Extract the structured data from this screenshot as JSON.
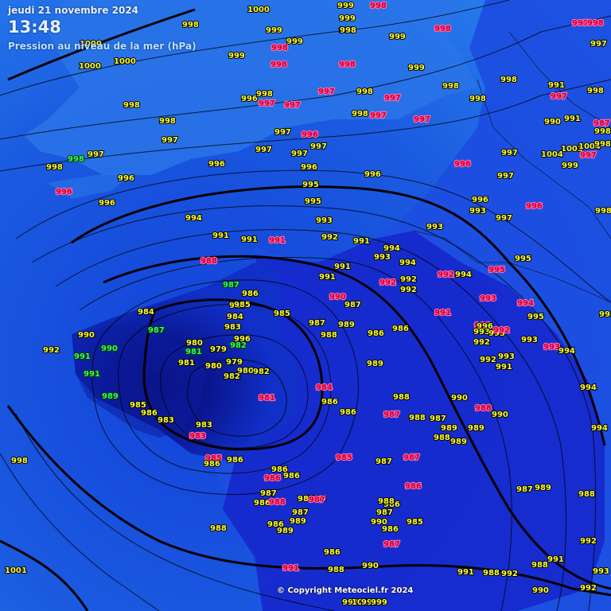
{
  "header": {
    "date": "jeudi 21 novembre 2024",
    "time": "13:48",
    "subtitle": "Pression au niveau de la mer (hPa)"
  },
  "copyright": "© Copyright Meteociel.fr 2024",
  "colors": {
    "normal_value": "#ffff33",
    "alert_value": "#cc0033",
    "alert_value_bg": "#ff66aa",
    "green_value": "#33ff66",
    "isobar": "#000000",
    "land_light": "#2070e0",
    "low_core": "#06169a"
  },
  "pressure_labels": [
    {
      "t": "1000",
      "c": "n"
    },
    {
      "t": "999",
      "c": "n"
    },
    {
      "t": "998",
      "c": "r"
    },
    {
      "t": "997",
      "c": "r"
    },
    {
      "t": "1000",
      "c": "n"
    },
    {
      "t": "998",
      "c": "n"
    },
    {
      "t": "999",
      "c": "n"
    },
    {
      "t": "998",
      "c": "r"
    },
    {
      "t": "1000",
      "c": "n"
    },
    {
      "t": "998",
      "c": "r"
    },
    {
      "t": "999",
      "c": "n"
    },
    {
      "t": "999",
      "c": "n"
    },
    {
      "t": "998",
      "c": "n"
    },
    {
      "t": "1000",
      "c": "n"
    },
    {
      "t": "999",
      "c": "n"
    },
    {
      "t": "998",
      "c": "r"
    },
    {
      "t": "998",
      "c": "r"
    },
    {
      "t": "998",
      "c": "n"
    },
    {
      "t": "999",
      "c": "n"
    },
    {
      "t": "998",
      "c": "r"
    },
    {
      "t": "999",
      "c": "n"
    },
    {
      "t": "998",
      "c": "n"
    },
    {
      "t": "998",
      "c": "n"
    },
    {
      "t": "998",
      "c": "n"
    },
    {
      "t": "996",
      "c": "n"
    },
    {
      "t": "998",
      "c": "n"
    },
    {
      "t": "997",
      "c": "r"
    },
    {
      "t": "997",
      "c": "r"
    },
    {
      "t": "997",
      "c": "r"
    },
    {
      "t": "998",
      "c": "n"
    },
    {
      "t": "997",
      "c": "r"
    },
    {
      "t": "997",
      "c": "r"
    },
    {
      "t": "998",
      "c": "n"
    },
    {
      "t": "997",
      "c": "r"
    },
    {
      "t": "997",
      "c": "n"
    },
    {
      "t": "998",
      "c": "n"
    },
    {
      "t": "997",
      "c": "n"
    },
    {
      "t": "996",
      "c": "r"
    },
    {
      "t": "997",
      "c": "n"
    },
    {
      "t": "997",
      "c": "r"
    },
    {
      "t": "998",
      "c": "n"
    },
    {
      "t": "998",
      "c": "n"
    },
    {
      "t": "997",
      "c": "n"
    },
    {
      "t": "997",
      "c": "n"
    },
    {
      "t": "997",
      "c": "n"
    },
    {
      "t": "996",
      "c": "n"
    },
    {
      "t": "996",
      "c": "n"
    },
    {
      "t": "996",
      "c": "r"
    },
    {
      "t": "996",
      "c": "n"
    },
    {
      "t": "997",
      "c": "n"
    },
    {
      "t": "996",
      "c": "n"
    },
    {
      "t": "998",
      "c": "g"
    },
    {
      "t": "998",
      "c": "n"
    },
    {
      "t": "997",
      "c": "n"
    },
    {
      "t": "996",
      "c": "r"
    },
    {
      "t": "996",
      "c": "n"
    },
    {
      "t": "995",
      "c": "n"
    },
    {
      "t": "995",
      "c": "n"
    },
    {
      "t": "994",
      "c": "n"
    },
    {
      "t": "993",
      "c": "n"
    },
    {
      "t": "993",
      "c": "n"
    },
    {
      "t": "996",
      "c": "n"
    },
    {
      "t": "997",
      "c": "n"
    },
    {
      "t": "997",
      "c": "n"
    },
    {
      "t": "998",
      "c": "n"
    },
    {
      "t": "996",
      "c": "r"
    },
    {
      "t": "991",
      "c": "n"
    },
    {
      "t": "991",
      "c": "n"
    },
    {
      "t": "991",
      "c": "r"
    },
    {
      "t": "992",
      "c": "n"
    },
    {
      "t": "991",
      "c": "n"
    },
    {
      "t": "994",
      "c": "n"
    },
    {
      "t": "993",
      "c": "n"
    },
    {
      "t": "988",
      "c": "r"
    },
    {
      "t": "991",
      "c": "n"
    },
    {
      "t": "993",
      "c": "n"
    },
    {
      "t": "991",
      "c": "n"
    },
    {
      "t": "992",
      "c": "r"
    },
    {
      "t": "994",
      "c": "n"
    },
    {
      "t": "992",
      "c": "n"
    },
    {
      "t": "992",
      "c": "n"
    },
    {
      "t": "995",
      "c": "n"
    },
    {
      "t": "992",
      "c": "r"
    },
    {
      "t": "994",
      "c": "n"
    },
    {
      "t": "995",
      "c": "r"
    },
    {
      "t": "987",
      "c": "g"
    },
    {
      "t": "986",
      "c": "n"
    },
    {
      "t": "990",
      "c": "r"
    },
    {
      "t": "987",
      "c": "n"
    },
    {
      "t": "991",
      "c": "r"
    },
    {
      "t": "993",
      "c": "r"
    },
    {
      "t": "994",
      "c": "r"
    },
    {
      "t": "984",
      "c": "n"
    },
    {
      "t": "985",
      "c": "n"
    },
    {
      "t": "984",
      "c": "n"
    },
    {
      "t": "985",
      "c": "n"
    },
    {
      "t": "985",
      "c": "n"
    },
    {
      "t": "987",
      "c": "n"
    },
    {
      "t": "989",
      "c": "n"
    },
    {
      "t": "986",
      "c": "n"
    },
    {
      "t": "991",
      "c": "r"
    },
    {
      "t": "996",
      "c": "n"
    },
    {
      "t": "995",
      "c": "n"
    },
    {
      "t": "993",
      "c": "n"
    },
    {
      "t": "998",
      "c": "n"
    },
    {
      "t": "987",
      "c": "g"
    },
    {
      "t": "983",
      "c": "n"
    },
    {
      "t": "988",
      "c": "n"
    },
    {
      "t": "986",
      "c": "n"
    },
    {
      "t": "993",
      "c": "n"
    },
    {
      "t": "992",
      "c": "r"
    },
    {
      "t": "993",
      "c": "n"
    },
    {
      "t": "993",
      "c": "r"
    },
    {
      "t": "994",
      "c": "n"
    },
    {
      "t": "990",
      "c": "n"
    },
    {
      "t": "990",
      "c": "g"
    },
    {
      "t": "980",
      "c": "n"
    },
    {
      "t": "979",
      "c": "n"
    },
    {
      "t": "982",
      "c": "g"
    },
    {
      "t": "996",
      "c": "n"
    },
    {
      "t": "992",
      "c": "n"
    },
    {
      "t": "991",
      "c": "g"
    },
    {
      "t": "981",
      "c": "g"
    },
    {
      "t": "992",
      "c": "n"
    },
    {
      "t": "992",
      "c": "n"
    },
    {
      "t": "993",
      "c": "n"
    },
    {
      "t": "991",
      "c": "n"
    },
    {
      "t": "991",
      "c": "g"
    },
    {
      "t": "981",
      "c": "n"
    },
    {
      "t": "980",
      "c": "n"
    },
    {
      "t": "979",
      "c": "n"
    },
    {
      "t": "980",
      "c": "n"
    },
    {
      "t": "982",
      "c": "n"
    },
    {
      "t": "989",
      "c": "n"
    },
    {
      "t": "982",
      "c": "n"
    },
    {
      "t": "984",
      "c": "r"
    },
    {
      "t": "994",
      "c": "n"
    },
    {
      "t": "989",
      "c": "g"
    },
    {
      "t": "981",
      "c": "r"
    },
    {
      "t": "988",
      "c": "n"
    },
    {
      "t": "990",
      "c": "n"
    },
    {
      "t": "985",
      "c": "n"
    },
    {
      "t": "986",
      "c": "n"
    },
    {
      "t": "986",
      "c": "n"
    },
    {
      "t": "988",
      "c": "r"
    },
    {
      "t": "990",
      "c": "n"
    },
    {
      "t": "986",
      "c": "n"
    },
    {
      "t": "983",
      "c": "n"
    },
    {
      "t": "987",
      "c": "r"
    },
    {
      "t": "988",
      "c": "n"
    },
    {
      "t": "987",
      "c": "n"
    },
    {
      "t": "983",
      "c": "n"
    },
    {
      "t": "989",
      "c": "n"
    },
    {
      "t": "989",
      "c": "n"
    },
    {
      "t": "994",
      "c": "n"
    },
    {
      "t": "983",
      "c": "r"
    },
    {
      "t": "988",
      "c": "n"
    },
    {
      "t": "989",
      "c": "n"
    },
    {
      "t": "998",
      "c": "n"
    },
    {
      "t": "985",
      "c": "r"
    },
    {
      "t": "986",
      "c": "n"
    },
    {
      "t": "986",
      "c": "n"
    },
    {
      "t": "986",
      "c": "n"
    },
    {
      "t": "985",
      "c": "r"
    },
    {
      "t": "987",
      "c": "n"
    },
    {
      "t": "986",
      "c": "r"
    },
    {
      "t": "987",
      "c": "r"
    },
    {
      "t": "986",
      "c": "n"
    },
    {
      "t": "986",
      "c": "r"
    },
    {
      "t": "987",
      "c": "n"
    },
    {
      "t": "986",
      "c": "n"
    },
    {
      "t": "987",
      "c": "n"
    },
    {
      "t": "989",
      "c": "n"
    },
    {
      "t": "987",
      "c": "r"
    },
    {
      "t": "988",
      "c": "r"
    },
    {
      "t": "986",
      "c": "n"
    },
    {
      "t": "987",
      "c": "n"
    },
    {
      "t": "989",
      "c": "n"
    },
    {
      "t": "988",
      "c": "n"
    },
    {
      "t": "987",
      "c": "n"
    },
    {
      "t": "989",
      "c": "n"
    },
    {
      "t": "990",
      "c": "n"
    },
    {
      "t": "988",
      "c": "n"
    },
    {
      "t": "987",
      "c": "n"
    },
    {
      "t": "986",
      "c": "n"
    },
    {
      "t": "985",
      "c": "n"
    },
    {
      "t": "986",
      "c": "n"
    },
    {
      "t": "987",
      "c": "r"
    },
    {
      "t": "988",
      "c": "n"
    },
    {
      "t": "989",
      "c": "n"
    },
    {
      "t": "986",
      "c": "n"
    },
    {
      "t": "988",
      "c": "n"
    },
    {
      "t": "1001",
      "c": "n"
    },
    {
      "t": "991",
      "c": "r"
    },
    {
      "t": "990",
      "c": "n"
    },
    {
      "t": "991",
      "c": "n"
    },
    {
      "t": "988",
      "c": "n"
    },
    {
      "t": "992",
      "c": "n"
    },
    {
      "t": "988",
      "c": "n"
    },
    {
      "t": "991",
      "c": "n"
    },
    {
      "t": "992",
      "c": "n"
    },
    {
      "t": "993",
      "c": "n"
    },
    {
      "t": "992",
      "c": "n"
    },
    {
      "t": "990",
      "c": "n"
    },
    {
      "t": "991",
      "c": "n"
    },
    {
      "t": "990",
      "c": "n"
    },
    {
      "t": "991",
      "c": "n"
    },
    {
      "t": "987",
      "c": "r"
    },
    {
      "t": "1003",
      "c": "n"
    },
    {
      "t": "1004",
      "c": "n"
    },
    {
      "t": "999",
      "c": "n"
    },
    {
      "t": "1004",
      "c": "n"
    },
    {
      "t": "998",
      "c": "n"
    },
    {
      "t": "997",
      "c": "r"
    },
    {
      "t": "998",
      "c": "n"
    },
    {
      "t": "999",
      "c": "n"
    },
    {
      "t": "1010",
      "c": "n"
    },
    {
      "t": "998",
      "c": "n"
    },
    {
      "t": "999",
      "c": "n"
    }
  ]
}
